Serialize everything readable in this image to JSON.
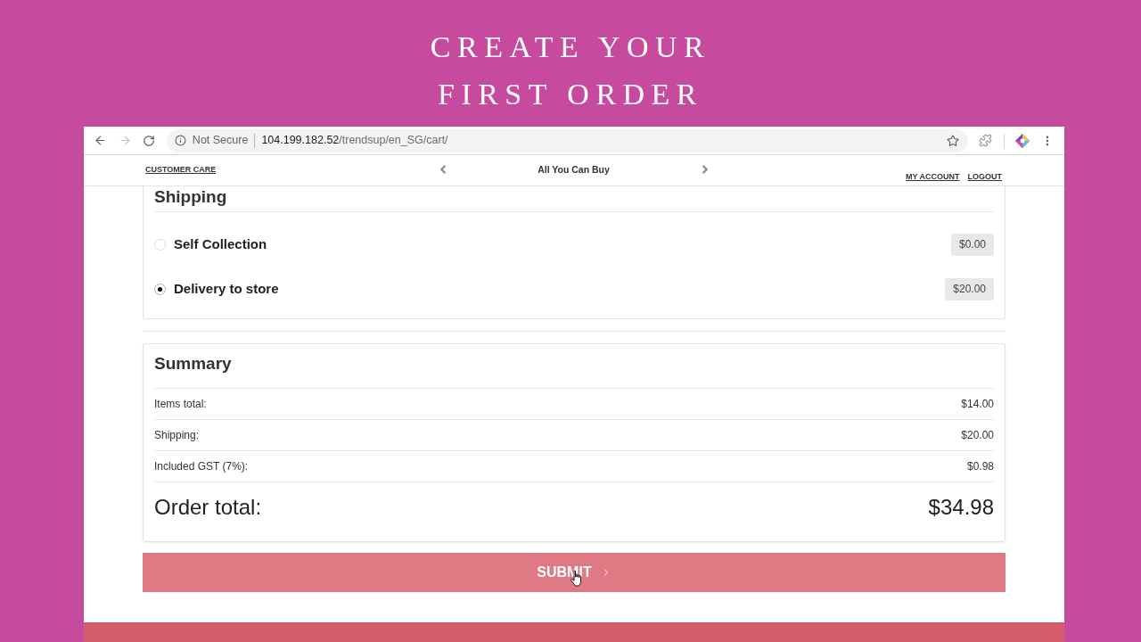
{
  "banner": {
    "title_lines": [
      "CREATE YOUR",
      "FIRST ORDER"
    ]
  },
  "browser": {
    "forward_disabled": true,
    "security_label": "Not Secure",
    "url_host": "104.199.182.52",
    "url_path": "/trendsup/en_SG/cart/"
  },
  "site_header": {
    "left_link": "CUSTOMER CARE",
    "carousel_text": "All You Can Buy",
    "account_links": [
      "MY ACCOUNT",
      "LOGOUT"
    ]
  },
  "shipping": {
    "title": "Shipping",
    "options": [
      {
        "label": "Self Collection",
        "price": "$0.00",
        "selected": false
      },
      {
        "label": "Delivery to store",
        "price": "$20.00",
        "selected": true
      }
    ]
  },
  "summary": {
    "title": "Summary",
    "rows": [
      {
        "label": "Items total:",
        "value": "$14.00"
      },
      {
        "label": "Shipping:",
        "value": "$20.00"
      },
      {
        "label": "Included GST (7%):",
        "value": "$0.98"
      }
    ],
    "total": {
      "label": "Order total:",
      "value": "$34.98"
    }
  },
  "submit_button": {
    "label": "SUBMIT"
  }
}
